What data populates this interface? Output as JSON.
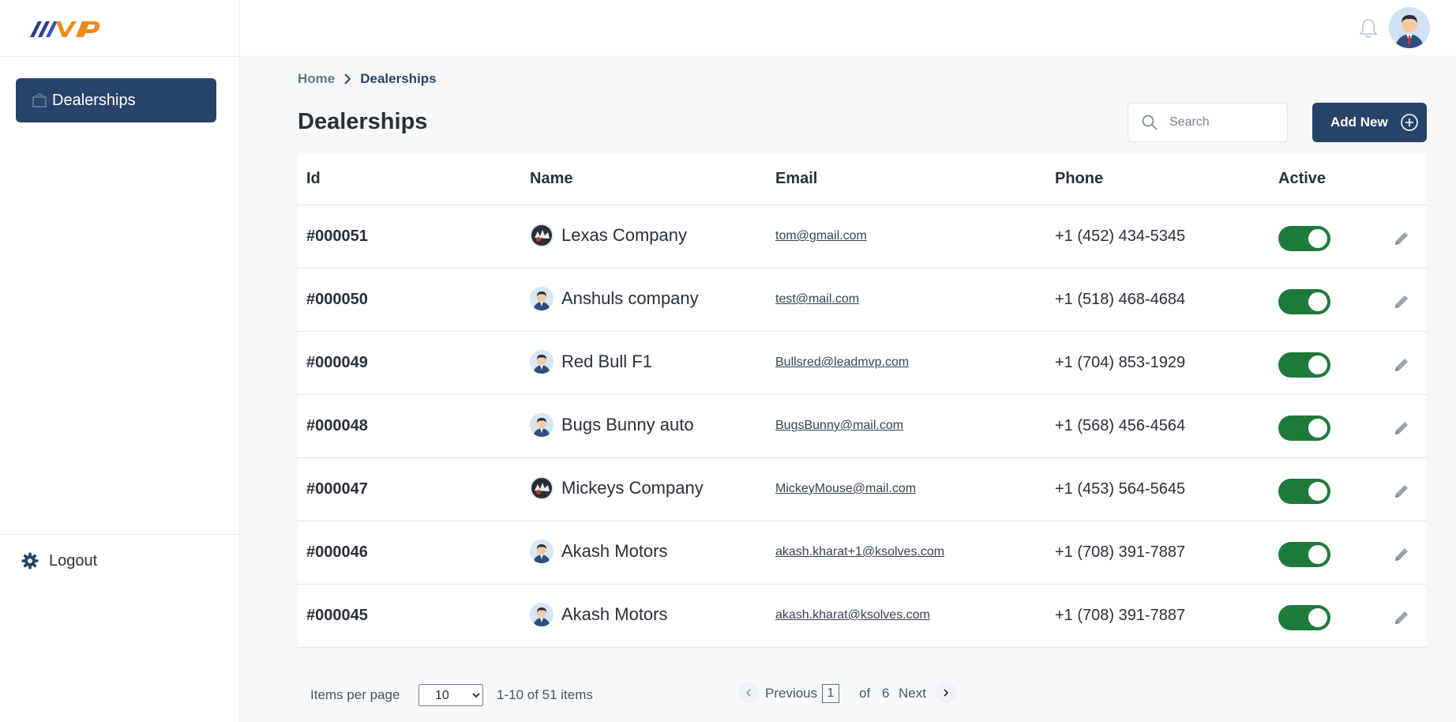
{
  "brand": {
    "logo_text": "MVP"
  },
  "sidebar": {
    "items": [
      {
        "label": "Dealerships",
        "icon": "dealership-icon",
        "active": true
      }
    ],
    "logout_label": "Logout"
  },
  "header": {
    "notifications_icon": "bell-icon",
    "avatar_icon": "user-avatar"
  },
  "breadcrumb": {
    "home": "Home",
    "current": "Dealerships"
  },
  "page": {
    "title": "Dealerships"
  },
  "search": {
    "placeholder": "Search",
    "value": ""
  },
  "toolbar": {
    "add_label": "Add New"
  },
  "table": {
    "columns": [
      "Id",
      "Name",
      "Email",
      "Phone",
      "Active"
    ],
    "rows": [
      {
        "id": "#000051",
        "name": "Lexas Company",
        "email": "tom@gmail.com",
        "phone": "+1 (452) 434-5345",
        "active": true,
        "avatar": "custom-image"
      },
      {
        "id": "#000050",
        "name": "Anshuls company",
        "email": "test@mail.com",
        "phone": "+1 (518) 468-4684",
        "active": true,
        "avatar": "default-user"
      },
      {
        "id": "#000049",
        "name": "Red Bull F1",
        "email": "Bullsred@leadmvp.com",
        "phone": "+1 (704) 853-1929",
        "active": true,
        "avatar": "default-user"
      },
      {
        "id": "#000048",
        "name": "Bugs Bunny auto",
        "email": "BugsBunny@mail.com",
        "phone": "+1 (568) 456-4564",
        "active": true,
        "avatar": "default-user"
      },
      {
        "id": "#000047",
        "name": "Mickeys Company",
        "email": "MickeyMouse@mail.com",
        "phone": "+1 (453) 564-5645",
        "active": true,
        "avatar": "custom-image"
      },
      {
        "id": "#000046",
        "name": "Akash Motors",
        "email": "akash.kharat+1@ksolves.com",
        "phone": "+1 (708) 391-7887",
        "active": true,
        "avatar": "default-user"
      },
      {
        "id": "#000045",
        "name": "Akash Motors",
        "email": "akash.kharat@ksolves.com",
        "phone": "+1 (708) 391-7887",
        "active": true,
        "avatar": "default-user"
      }
    ]
  },
  "pagination": {
    "items_per_page_label": "Items per page",
    "items_per_page": "10",
    "range": "1-10 of 51 items",
    "previous": "Previous",
    "current_page": "1",
    "of": "of",
    "total_pages": "6",
    "next": "Next"
  },
  "colors": {
    "primary": "#27446a",
    "active_toggle": "#1e7a3c",
    "background": "#f7f8fa"
  }
}
